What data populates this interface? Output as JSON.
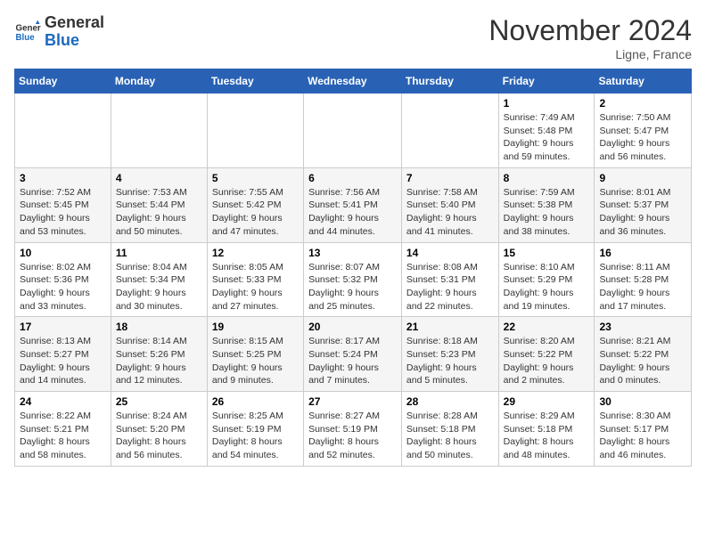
{
  "logo": {
    "text_general": "General",
    "text_blue": "Blue"
  },
  "header": {
    "month": "November 2024",
    "location": "Ligne, France"
  },
  "weekdays": [
    "Sunday",
    "Monday",
    "Tuesday",
    "Wednesday",
    "Thursday",
    "Friday",
    "Saturday"
  ],
  "weeks": [
    [
      {
        "day": "",
        "info": ""
      },
      {
        "day": "",
        "info": ""
      },
      {
        "day": "",
        "info": ""
      },
      {
        "day": "",
        "info": ""
      },
      {
        "day": "",
        "info": ""
      },
      {
        "day": "1",
        "info": "Sunrise: 7:49 AM\nSunset: 5:48 PM\nDaylight: 9 hours and 59 minutes."
      },
      {
        "day": "2",
        "info": "Sunrise: 7:50 AM\nSunset: 5:47 PM\nDaylight: 9 hours and 56 minutes."
      }
    ],
    [
      {
        "day": "3",
        "info": "Sunrise: 7:52 AM\nSunset: 5:45 PM\nDaylight: 9 hours and 53 minutes."
      },
      {
        "day": "4",
        "info": "Sunrise: 7:53 AM\nSunset: 5:44 PM\nDaylight: 9 hours and 50 minutes."
      },
      {
        "day": "5",
        "info": "Sunrise: 7:55 AM\nSunset: 5:42 PM\nDaylight: 9 hours and 47 minutes."
      },
      {
        "day": "6",
        "info": "Sunrise: 7:56 AM\nSunset: 5:41 PM\nDaylight: 9 hours and 44 minutes."
      },
      {
        "day": "7",
        "info": "Sunrise: 7:58 AM\nSunset: 5:40 PM\nDaylight: 9 hours and 41 minutes."
      },
      {
        "day": "8",
        "info": "Sunrise: 7:59 AM\nSunset: 5:38 PM\nDaylight: 9 hours and 38 minutes."
      },
      {
        "day": "9",
        "info": "Sunrise: 8:01 AM\nSunset: 5:37 PM\nDaylight: 9 hours and 36 minutes."
      }
    ],
    [
      {
        "day": "10",
        "info": "Sunrise: 8:02 AM\nSunset: 5:36 PM\nDaylight: 9 hours and 33 minutes."
      },
      {
        "day": "11",
        "info": "Sunrise: 8:04 AM\nSunset: 5:34 PM\nDaylight: 9 hours and 30 minutes."
      },
      {
        "day": "12",
        "info": "Sunrise: 8:05 AM\nSunset: 5:33 PM\nDaylight: 9 hours and 27 minutes."
      },
      {
        "day": "13",
        "info": "Sunrise: 8:07 AM\nSunset: 5:32 PM\nDaylight: 9 hours and 25 minutes."
      },
      {
        "day": "14",
        "info": "Sunrise: 8:08 AM\nSunset: 5:31 PM\nDaylight: 9 hours and 22 minutes."
      },
      {
        "day": "15",
        "info": "Sunrise: 8:10 AM\nSunset: 5:29 PM\nDaylight: 9 hours and 19 minutes."
      },
      {
        "day": "16",
        "info": "Sunrise: 8:11 AM\nSunset: 5:28 PM\nDaylight: 9 hours and 17 minutes."
      }
    ],
    [
      {
        "day": "17",
        "info": "Sunrise: 8:13 AM\nSunset: 5:27 PM\nDaylight: 9 hours and 14 minutes."
      },
      {
        "day": "18",
        "info": "Sunrise: 8:14 AM\nSunset: 5:26 PM\nDaylight: 9 hours and 12 minutes."
      },
      {
        "day": "19",
        "info": "Sunrise: 8:15 AM\nSunset: 5:25 PM\nDaylight: 9 hours and 9 minutes."
      },
      {
        "day": "20",
        "info": "Sunrise: 8:17 AM\nSunset: 5:24 PM\nDaylight: 9 hours and 7 minutes."
      },
      {
        "day": "21",
        "info": "Sunrise: 8:18 AM\nSunset: 5:23 PM\nDaylight: 9 hours and 5 minutes."
      },
      {
        "day": "22",
        "info": "Sunrise: 8:20 AM\nSunset: 5:22 PM\nDaylight: 9 hours and 2 minutes."
      },
      {
        "day": "23",
        "info": "Sunrise: 8:21 AM\nSunset: 5:22 PM\nDaylight: 9 hours and 0 minutes."
      }
    ],
    [
      {
        "day": "24",
        "info": "Sunrise: 8:22 AM\nSunset: 5:21 PM\nDaylight: 8 hours and 58 minutes."
      },
      {
        "day": "25",
        "info": "Sunrise: 8:24 AM\nSunset: 5:20 PM\nDaylight: 8 hours and 56 minutes."
      },
      {
        "day": "26",
        "info": "Sunrise: 8:25 AM\nSunset: 5:19 PM\nDaylight: 8 hours and 54 minutes."
      },
      {
        "day": "27",
        "info": "Sunrise: 8:27 AM\nSunset: 5:19 PM\nDaylight: 8 hours and 52 minutes."
      },
      {
        "day": "28",
        "info": "Sunrise: 8:28 AM\nSunset: 5:18 PM\nDaylight: 8 hours and 50 minutes."
      },
      {
        "day": "29",
        "info": "Sunrise: 8:29 AM\nSunset: 5:18 PM\nDaylight: 8 hours and 48 minutes."
      },
      {
        "day": "30",
        "info": "Sunrise: 8:30 AM\nSunset: 5:17 PM\nDaylight: 8 hours and 46 minutes."
      }
    ]
  ]
}
